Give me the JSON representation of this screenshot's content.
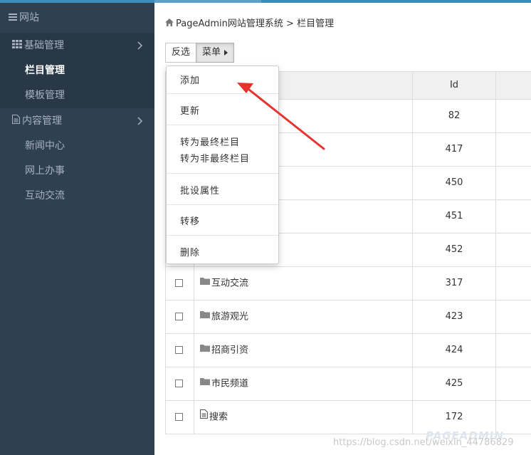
{
  "sidebar": {
    "header": "网站",
    "groups": [
      {
        "label": "基础管理",
        "children": [
          "栏目管理",
          "模板管理"
        ]
      },
      {
        "label": "内容管理",
        "children": [
          "新闻中心",
          "网上办事",
          "互动交流"
        ]
      }
    ],
    "active_item": "栏目管理"
  },
  "breadcrumb": {
    "site": "PageAdmin网站管理系统",
    "separator": ">",
    "current": "栏目管理"
  },
  "toolbar": {
    "invert_label": "反选",
    "menu_label": "菜单"
  },
  "table": {
    "columns": [
      "",
      "",
      "Id",
      ""
    ],
    "rows": [
      {
        "name": "",
        "id": "82"
      },
      {
        "name": "",
        "id": "417"
      },
      {
        "name": "",
        "id": "450"
      },
      {
        "name": "",
        "id": "451"
      },
      {
        "name": "",
        "id": "452"
      },
      {
        "name": "互动交流",
        "id": "317",
        "icon": "folder-icon"
      },
      {
        "name": "旅游观光",
        "id": "423",
        "icon": "folder-icon"
      },
      {
        "name": "招商引资",
        "id": "424",
        "icon": "folder-icon"
      },
      {
        "name": "市民频道",
        "id": "425",
        "icon": "folder-icon"
      },
      {
        "name": "搜索",
        "id": "172",
        "icon": "page-icon"
      }
    ]
  },
  "dropdown": {
    "items": [
      "添加",
      "更新",
      "转为最终栏目",
      "转为非最终栏目",
      "批设属性",
      "转移",
      "删除"
    ]
  },
  "annotation": {
    "arrow_color": "#e8322d"
  },
  "watermark": {
    "url": "https://blog.csdn.net/weixin_44786829",
    "logo": "PAGEADMIN"
  }
}
